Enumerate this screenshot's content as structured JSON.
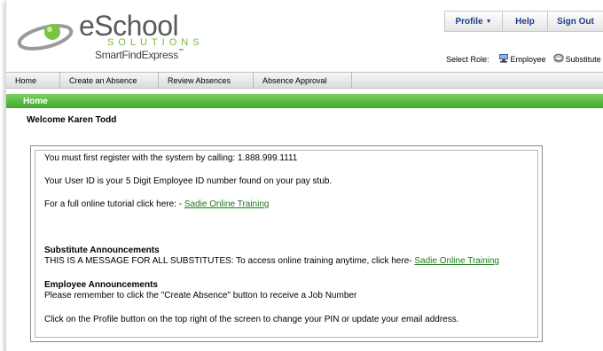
{
  "logo": {
    "name": "eSchool",
    "solutions": "SOLUTIONS",
    "product": "SmartFindExpress",
    "tm": "™"
  },
  "topnav": {
    "profile": "Profile",
    "help": "Help",
    "signout": "Sign Out"
  },
  "role": {
    "label": "Select Role:",
    "employee": "Employee",
    "substitute": "Substitute"
  },
  "nav": {
    "items": [
      "Home",
      "Create an Absence",
      "Review Absences",
      "Absence Approval"
    ]
  },
  "section": {
    "title": "Home"
  },
  "welcome": "Welcome Karen Todd",
  "content": {
    "register": "You must first register with the system by calling: 1.888.999.1111",
    "userid": "Your User ID is your 5 Digit Employee ID number found on your pay stub.",
    "tutorial_text": "For a full online tutorial click here: - ",
    "tutorial_link": "Sadie Online Training",
    "sub_heading": "Substitute Announcements",
    "sub_text": "THIS IS A MESSAGE FOR ALL SUBSTITUTES: To access online training anytime, click here- ",
    "sub_link": "Sadie Online Training",
    "emp_heading": "Employee Announcements",
    "emp_text": "Please remember to click the \"Create Absence\" button to receive a Job Number",
    "profile_text": "Click on the Profile button on the top right of the screen to change your PIN or update your email address."
  },
  "colors": {
    "green_bar": "#4cb336",
    "link": "#1a7a1a",
    "topnav_text": "#1d3d86"
  }
}
